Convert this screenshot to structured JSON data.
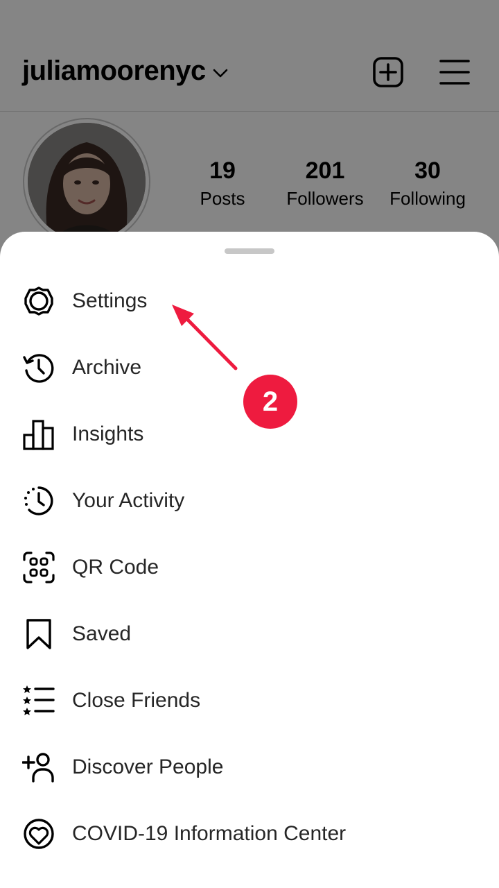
{
  "profile": {
    "username": "juliamoorenyc",
    "stats": [
      {
        "value": "19",
        "label": "Posts"
      },
      {
        "value": "201",
        "label": "Followers"
      },
      {
        "value": "30",
        "label": "Following"
      }
    ]
  },
  "menu": {
    "items": [
      {
        "label": "Settings",
        "icon": "settings-gear-icon"
      },
      {
        "label": "Archive",
        "icon": "archive-history-icon"
      },
      {
        "label": "Insights",
        "icon": "insights-bar-chart-icon"
      },
      {
        "label": "Your Activity",
        "icon": "activity-clock-icon"
      },
      {
        "label": "QR Code",
        "icon": "qr-code-icon"
      },
      {
        "label": "Saved",
        "icon": "bookmark-icon"
      },
      {
        "label": "Close Friends",
        "icon": "close-friends-list-icon"
      },
      {
        "label": "Discover People",
        "icon": "add-person-icon"
      },
      {
        "label": "COVID-19 Information Center",
        "icon": "heart-circle-icon"
      }
    ]
  },
  "annotation": {
    "step_number": "2",
    "color": "#ee1b3f"
  }
}
